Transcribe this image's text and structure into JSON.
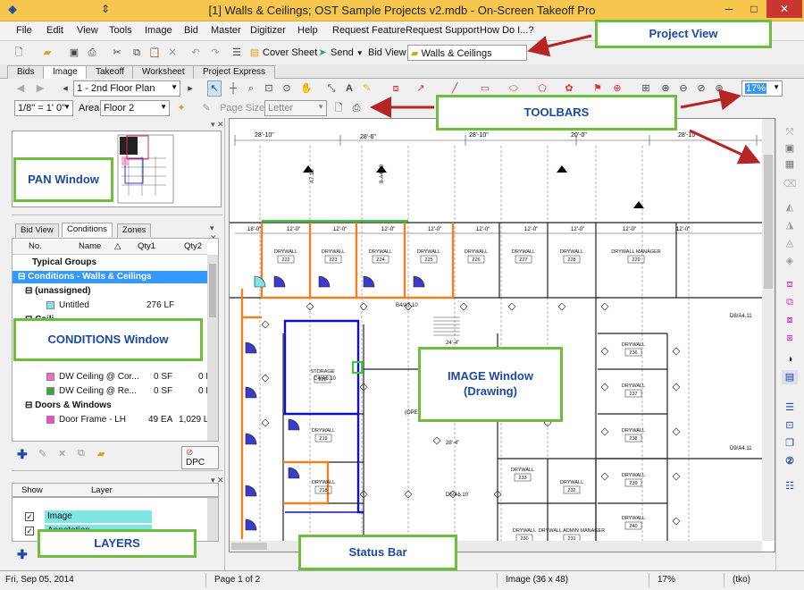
{
  "window": {
    "title": "[1] Walls & Ceilings; OST Sample Projects v2.mdb - On-Screen Takeoff Pro"
  },
  "menu": [
    "File",
    "Edit",
    "View",
    "Tools",
    "Image",
    "Bid",
    "Master",
    "Digitizer",
    "Help",
    "Request Feature",
    "Request Support",
    "How Do I...?"
  ],
  "toolbar1": {
    "cover_sheet": "Cover Sheet",
    "send": "Send",
    "bid_view_label": "Bid View",
    "bid_view_value": "Walls & Ceilings"
  },
  "tabs": [
    "Bids",
    "Image",
    "Takeoff",
    "Worksheet",
    "Project Express"
  ],
  "toolbar2": {
    "page": "1 - 2nd Floor Plan",
    "zoom": "17%"
  },
  "toolbar3": {
    "scale": "1/8\" = 1' 0\"",
    "area_label": "Area",
    "area": "Floor 2",
    "page_size_label": "Page Size",
    "page_size": "Letter"
  },
  "left_tabs": [
    "Bid View",
    "Conditions",
    "Zones"
  ],
  "cond_headers": {
    "no": "No.",
    "name": "Name",
    "qty1": "Qty1",
    "qty2": "Qty2"
  },
  "conditions": [
    {
      "name": "Typical Groups",
      "qty1": "",
      "qty2": "",
      "type": "group"
    },
    {
      "name": "Conditions - Walls & Ceilings",
      "qty1": "",
      "qty2": "",
      "type": "selected"
    },
    {
      "name": "(unassigned)",
      "qty1": "",
      "qty2": "",
      "type": "sub"
    },
    {
      "name": "Untitled",
      "qty1": "276 LF",
      "qty2": "",
      "type": "item",
      "color": "#7fe5e5"
    },
    {
      "name": "Ceili",
      "qty1": "",
      "qty2": "",
      "type": "sub"
    },
    {
      "name": "DW Ceiling @ Cor...",
      "qty1": "0 SF",
      "qty2": "0 L",
      "type": "item",
      "color": "#ff66cc"
    },
    {
      "name": "DW Ceiling @ Re...",
      "qty1": "0 SF",
      "qty2": "0 L",
      "type": "item",
      "color": "#33aa33"
    },
    {
      "name": "Doors & Windows",
      "qty1": "",
      "qty2": "",
      "type": "sub"
    },
    {
      "name": "Door Frame - LH",
      "qty1": "49 EA",
      "qty2": "1,029 L",
      "type": "item",
      "color": "#ff44cc"
    }
  ],
  "cond_buttons": {
    "dpc": "DPC"
  },
  "layers": {
    "show": "Show",
    "layer": "Layer",
    "rows": [
      "Image",
      "Annotation"
    ]
  },
  "drawing": {
    "dims_top": [
      "28'-10\"",
      "28'-6\"",
      "28'-10\"",
      "20'-0\"",
      "28'-10\""
    ],
    "dims_row": [
      "18'-0\"",
      "12'-0\"",
      "12'-0\"",
      "12'-0\"",
      "12'-0\"",
      "12'-0\"",
      "12'-0\"",
      "12'-0\"",
      "12'-0\"",
      "12'-0\""
    ],
    "rooms": [
      {
        "label": "DRYWALL",
        "num": "222"
      },
      {
        "label": "DRYWALL",
        "num": "223"
      },
      {
        "label": "DRYWALL",
        "num": "224"
      },
      {
        "label": "DRYWALL",
        "num": "225"
      },
      {
        "label": "DRYWALL",
        "num": "226"
      },
      {
        "label": "DRYWALL",
        "num": "227"
      },
      {
        "label": "DRYWALL",
        "num": "228"
      },
      {
        "label": "DRYWALL MANAGER",
        "num": "229"
      },
      {
        "label": "STORAGE",
        "num": "220"
      },
      {
        "label": "DRYWALL",
        "num": "219"
      },
      {
        "label": "DRYWALL",
        "num": "218"
      },
      {
        "label": "DRYWALL",
        "num": "236"
      },
      {
        "label": "DRYWALL",
        "num": "237"
      },
      {
        "label": "DRYWALL",
        "num": "238"
      },
      {
        "label": "DRYWALL",
        "num": "239"
      },
      {
        "label": "DRYWALL",
        "num": "240"
      },
      {
        "label": "DRYWALL",
        "num": "233"
      },
      {
        "label": "DRYWALL",
        "num": "232"
      },
      {
        "label": "DRYWALL ADMIN MANAGER",
        "num": "231"
      },
      {
        "label": "DRYWALL",
        "num": "230"
      }
    ],
    "misc": [
      "24'-4\"",
      "28'-4\"",
      "D5/A6.10",
      "C4/A6.10",
      "B4/A7.10",
      "A7.10",
      "8-A4.10",
      "D8/A4.11",
      "D9/A4.11",
      "(OPE"
    ]
  },
  "status": {
    "date": "Fri, Sep 05, 2014",
    "page": "Page 1 of 2",
    "image": "Image (36 x 48)",
    "zoom": "17%",
    "user": "(tko)"
  },
  "callouts": {
    "project_view": "Project View",
    "toolbars": "TOOLBARS",
    "pan": "PAN Window",
    "conditions": "CONDITIONS Window",
    "image_line1": "IMAGE Window",
    "image_line2": "(Drawing)",
    "layers": "LAYERS",
    "status": "Status Bar"
  }
}
